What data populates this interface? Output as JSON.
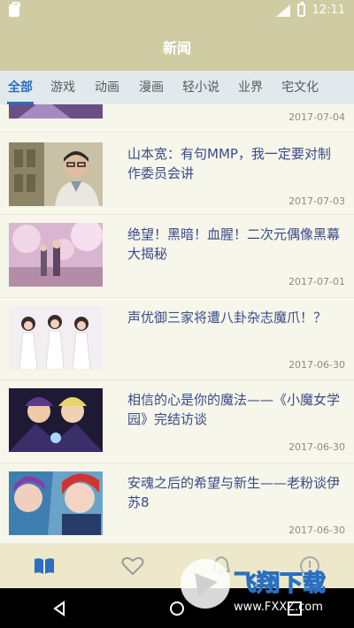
{
  "status": {
    "time": "12:11"
  },
  "header": {
    "title": "新闻"
  },
  "tabs": [
    {
      "label": "全部",
      "active": true
    },
    {
      "label": "游戏"
    },
    {
      "label": "动画"
    },
    {
      "label": "漫画"
    },
    {
      "label": "轻小说"
    },
    {
      "label": "业界"
    },
    {
      "label": "宅文化"
    }
  ],
  "news": [
    {
      "title": "",
      "date": "2017-07-04"
    },
    {
      "title": "山本宽：有句MMP，我一定要对制作委员会讲",
      "date": "2017-07-03"
    },
    {
      "title": "绝望！黑暗！血腥！二次元偶像黑幕大揭秘",
      "date": "2017-07-01"
    },
    {
      "title": "声优御三家将遭八卦杂志魔爪！？",
      "date": "2017-06-30"
    },
    {
      "title": "相信的心是你的魔法——《小魔女学园》完结访谈",
      "date": "2017-06-30"
    },
    {
      "title": "安魂之后的希望与新生——老粉谈伊苏8",
      "date": "2017-06-30"
    }
  ],
  "bottom_nav": [
    {
      "icon": "book-icon",
      "active": true
    },
    {
      "icon": "heart-icon"
    },
    {
      "icon": "bell-icon"
    },
    {
      "icon": "info-icon"
    }
  ],
  "watermark": {
    "brand": "飞翔下载",
    "url": "www.FXXZ.com"
  },
  "colors": {
    "header": "#cfcba2",
    "accent": "#2a6fc1",
    "headline": "#3a4a8a"
  }
}
